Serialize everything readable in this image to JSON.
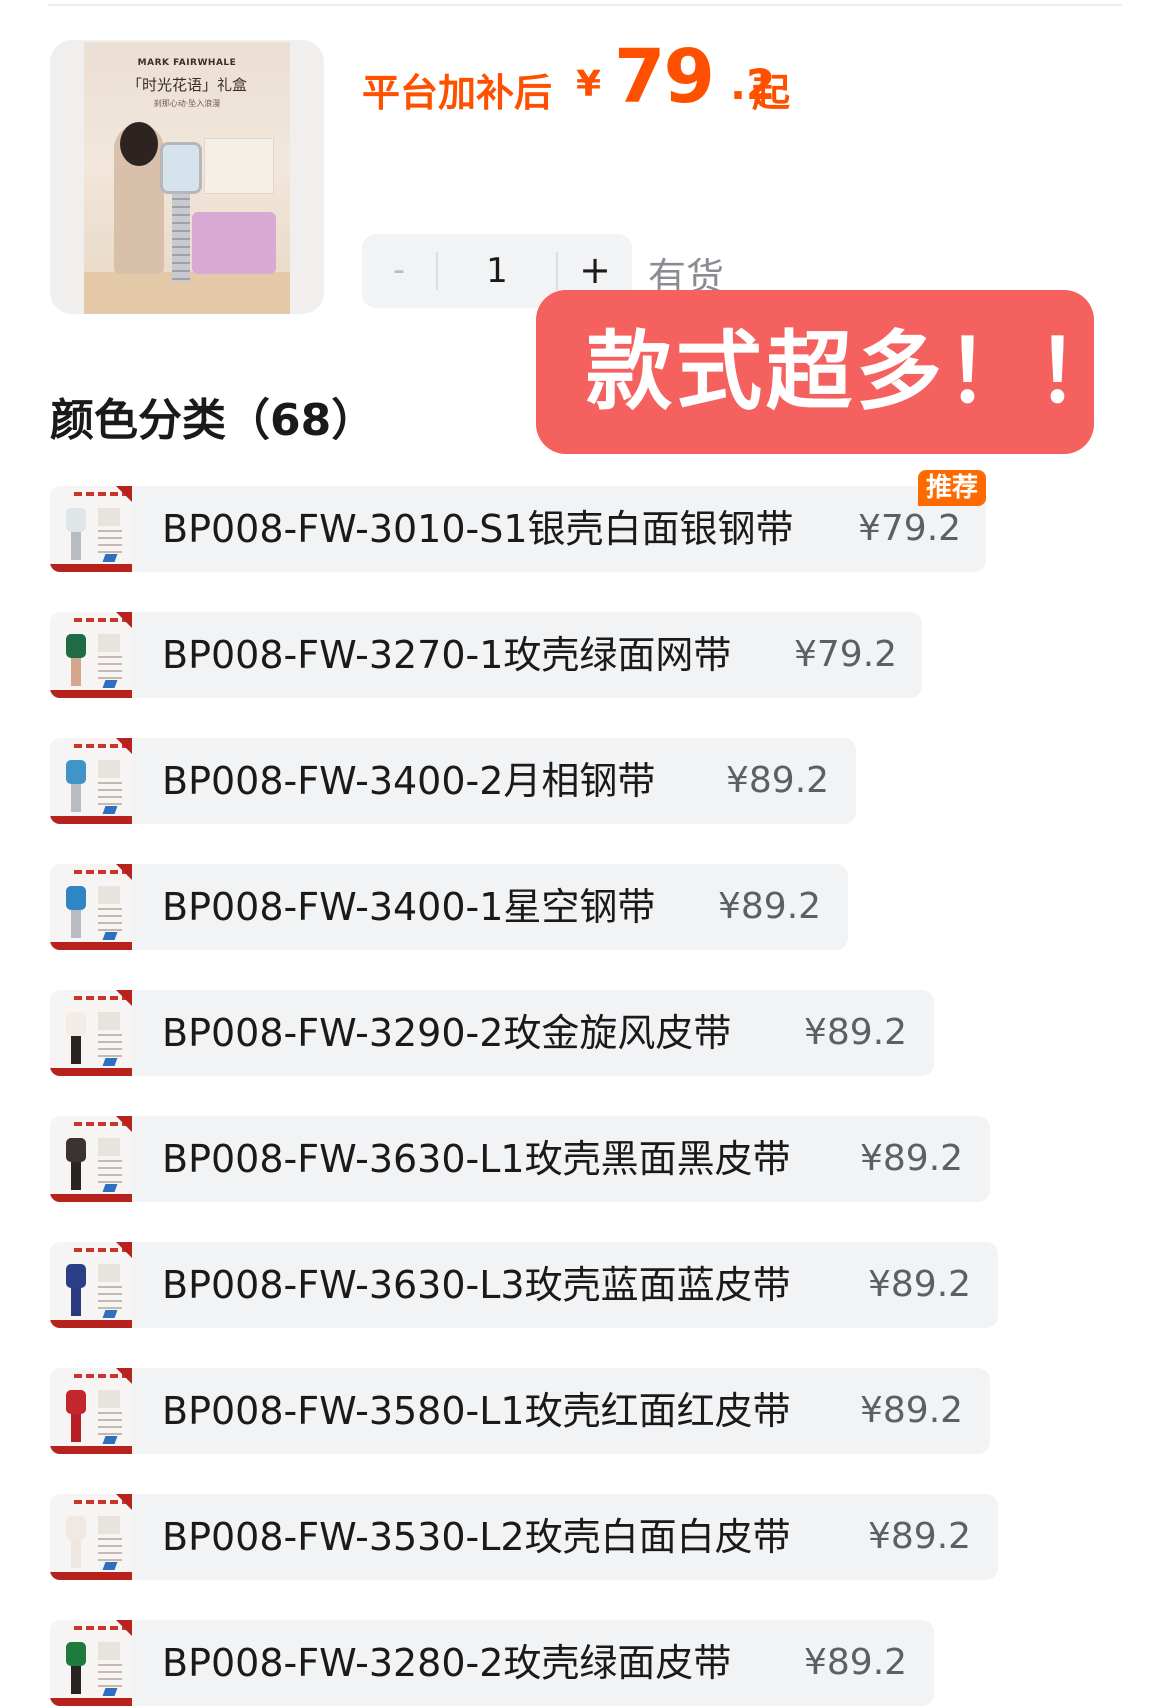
{
  "product": {
    "image": {
      "brand": "MARK FAIRWHALE",
      "title": "「时光花语」礼盒",
      "subtitle": "刹那心动·坠入浪漫"
    },
    "price": {
      "prefix": "平台加补后",
      "symbol": "¥",
      "integer": "79",
      "decimal": ".2",
      "suffix": "起"
    },
    "quantity": {
      "minus_label": "-",
      "value": "1",
      "plus_label": "+"
    },
    "stock_status": "有货"
  },
  "banner": {
    "text": "款式超多！！",
    "color": "#f4615f"
  },
  "variants": {
    "title": "颜色分类（68）",
    "items": [
      {
        "name": "BP008-FW-3010-S1银壳白面银钢带",
        "price": "¥79.2",
        "badge": "推荐",
        "dial": "#dfe6ea",
        "strap": "#b8bcc2"
      },
      {
        "name": "BP008-FW-3270-1玫壳绿面网带",
        "price": "¥79.2",
        "badge": "",
        "dial": "#1f6b45",
        "strap": "#d4a68e"
      },
      {
        "name": "BP008-FW-3400-2月相钢带",
        "price": "¥89.2",
        "badge": "",
        "dial": "#3f95c8",
        "strap": "#b8bcc2"
      },
      {
        "name": "BP008-FW-3400-1星空钢带",
        "price": "¥89.2",
        "badge": "",
        "dial": "#2f86c4",
        "strap": "#b8bcc2"
      },
      {
        "name": "BP008-FW-3290-2玫金旋风皮带",
        "price": "¥89.2",
        "badge": "",
        "dial": "#f3ece6",
        "strap": "#2a2522"
      },
      {
        "name": "BP008-FW-3630-L1玫壳黑面黑皮带",
        "price": "¥89.2",
        "badge": "",
        "dial": "#3a3330",
        "strap": "#2a2522"
      },
      {
        "name": "BP008-FW-3630-L3玫壳蓝面蓝皮带",
        "price": "¥89.2",
        "badge": "",
        "dial": "#2b3f86",
        "strap": "#2a3a7c"
      },
      {
        "name": "BP008-FW-3580-L1玫壳红面红皮带",
        "price": "¥89.2",
        "badge": "",
        "dial": "#c3262b",
        "strap": "#b81e26"
      },
      {
        "name": "BP008-FW-3530-L2玫壳白面白皮带",
        "price": "¥89.2",
        "badge": "",
        "dial": "#f1e8e2",
        "strap": "#eee6e0"
      },
      {
        "name": "BP008-FW-3280-2玫壳绿面皮带",
        "price": "¥89.2",
        "badge": "",
        "dial": "#1f7a3c",
        "strap": "#2a2522"
      }
    ]
  },
  "colors": {
    "price_accent": "#ff5000",
    "badge": "#ff6a00"
  }
}
